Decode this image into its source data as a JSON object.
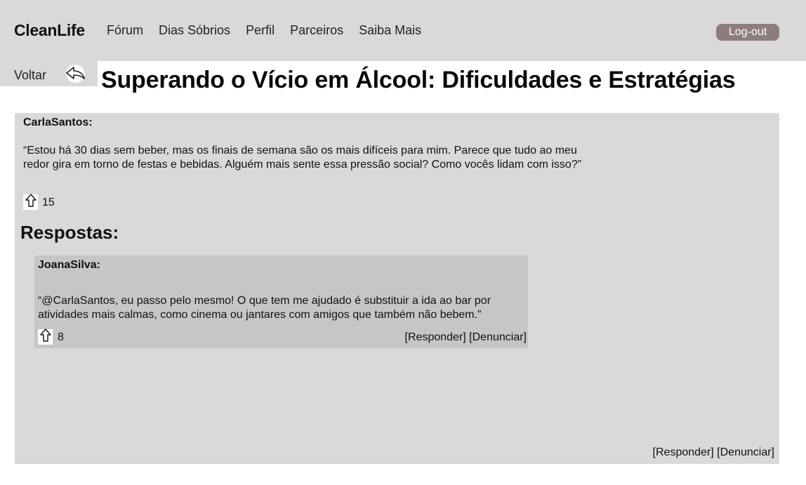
{
  "header": {
    "brand": "CleanLife",
    "nav": [
      "Fórum",
      "Dias Sóbrios",
      "Perfil",
      "Parceiros",
      "Saiba Mais"
    ],
    "logout_label": "Log-out"
  },
  "back": {
    "label": "Voltar",
    "icon": "reply-arrow-icon"
  },
  "page_title": "Superando o Vício em Álcool: Dificuldades e Estratégias",
  "post": {
    "author": "CarlaSantos:",
    "text": "“Estou há 30 dias sem beber, mas os finais de semana são os mais difíceis para mim. Parece que tudo ao meu redor gira em torno de festas e bebidas. Alguém mais sente essa pressão social? Como vocês lidam com isso?”",
    "upvotes": "15",
    "reply_label": "[Responder]",
    "report_label": "[Denunciar]"
  },
  "answers_heading": "Respostas:",
  "replies": [
    {
      "author": "JoanaSilva:",
      "text": "“@CarlaSantos, eu passo pelo mesmo! O que tem me ajudado é substituir a ida ao bar por atividades mais calmas, como cinema ou jantares com amigos que também não bebem.”",
      "upvotes": "8",
      "reply_label": "[Responder]",
      "report_label": "[Denunciar]"
    }
  ],
  "colors": {
    "header_bg": "#d9d9d9",
    "panel_bg": "#d9d9d9",
    "reply_bg": "#c6c6c6",
    "logout_bg": "#8e7d7d"
  }
}
